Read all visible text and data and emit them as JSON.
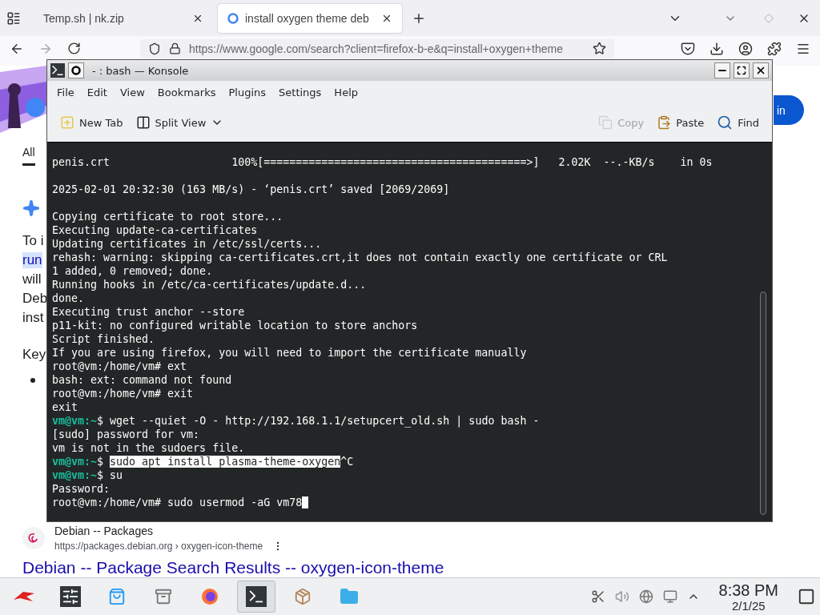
{
  "browser": {
    "tabs": [
      {
        "title": "Temp.sh | nk.zip",
        "selected": false
      },
      {
        "title": "install oxygen theme deb",
        "selected": true
      }
    ],
    "url": "https://www.google.com/search?client=firefox-b-e&q=install+oxygen+theme",
    "page": {
      "sign_in": "in",
      "filter_tab": {
        "label": "All",
        "selected": true
      },
      "snippet": [
        {
          "text": "To i",
          "highlighted": false
        },
        {
          "text": "run",
          "highlighted": true
        },
        {
          "text": "will",
          "highlighted": false
        },
        {
          "text": "Deb",
          "highlighted": false
        },
        {
          "text": "inst",
          "highlighted": false
        }
      ],
      "heading": "Key",
      "result": {
        "site": "Debian -- Packages",
        "url": "https://packages.debian.org › oxygen-icon-theme",
        "title": "Debian -- Package Search Results -- oxygen-icon-theme"
      }
    }
  },
  "konsole": {
    "title": "- : bash — Konsole",
    "menu": [
      "File",
      "Edit",
      "View",
      "Bookmarks",
      "Plugins",
      "Settings",
      "Help"
    ],
    "toolbar": [
      {
        "label": "New Tab",
        "kind": "new_tab",
        "disabled": false
      },
      {
        "label": "Split View",
        "kind": "split",
        "disabled": false
      },
      {
        "label": "Copy",
        "kind": "copy",
        "disabled": true
      },
      {
        "label": "Paste",
        "kind": "paste",
        "disabled": false
      },
      {
        "label": "Find",
        "kind": "find",
        "disabled": false
      }
    ],
    "lines": [
      {
        "kind": "output",
        "text": "penis.crt                   100%[=========================================>]   2.02K  --.-KB/s    in 0s"
      },
      {
        "kind": "blank"
      },
      {
        "kind": "output",
        "text": "2025-02-01 20:32:30 (163 MB/s) - ‘penis.crt’ saved [2069/2069]"
      },
      {
        "kind": "blank"
      },
      {
        "kind": "output",
        "text": "Copying certificate to root store..."
      },
      {
        "kind": "output",
        "text": "Executing update-ca-certificates"
      },
      {
        "kind": "output",
        "text": "Updating certificates in /etc/ssl/certs..."
      },
      {
        "kind": "output",
        "text": "rehash: warning: skipping ca-certificates.crt,it does not contain exactly one certificate or CRL"
      },
      {
        "kind": "output",
        "text": "1 added, 0 removed; done."
      },
      {
        "kind": "output",
        "text": "Running hooks in /etc/ca-certificates/update.d..."
      },
      {
        "kind": "output",
        "text": "done."
      },
      {
        "kind": "output",
        "text": "Executing trust anchor --store"
      },
      {
        "kind": "output",
        "text": "p11-kit: no configured writable location to store anchors"
      },
      {
        "kind": "output",
        "text": "Script finished."
      },
      {
        "kind": "output",
        "text": "If you are using firefox, you will need to import the certificate manually"
      },
      {
        "kind": "output",
        "text": "root@vm:/home/vm# ext"
      },
      {
        "kind": "output",
        "text": "bash: ext: command not found"
      },
      {
        "kind": "output",
        "text": "root@vm:/home/vm# exit"
      },
      {
        "kind": "output",
        "text": "exit"
      },
      {
        "kind": "user_prompt",
        "prompt": "vm@vm:~",
        "sign": "$",
        "text": " wget --quiet -O - http://192.168.1.1/setupcert_old.sh | sudo bash -"
      },
      {
        "kind": "output",
        "text": "[sudo] password for vm:"
      },
      {
        "kind": "output",
        "text": "vm is not in the sudoers file."
      },
      {
        "kind": "user_prompt",
        "prompt": "vm@vm:~",
        "sign": "$",
        "selection": "sudo apt install plasma-theme-oxygen",
        "text": "^C"
      },
      {
        "kind": "user_prompt",
        "prompt": "vm@vm:~",
        "sign": "$",
        "text": " su"
      },
      {
        "kind": "output",
        "text": "Password:"
      },
      {
        "kind": "output",
        "text": "root@vm:/home/vm# sudo usermod -aG vm78",
        "cursor": true
      }
    ]
  },
  "taskbar": {
    "apps": [
      {
        "kind": "menu",
        "active": false
      },
      {
        "kind": "settings",
        "active": false
      },
      {
        "kind": "store",
        "active": false
      },
      {
        "kind": "archive",
        "active": false
      },
      {
        "kind": "firefox",
        "active": false
      },
      {
        "kind": "terminal",
        "active": true
      },
      {
        "kind": "package",
        "active": false
      },
      {
        "kind": "folder",
        "active": false
      }
    ],
    "time": "8:38 PM",
    "date": "2/1/25"
  }
}
